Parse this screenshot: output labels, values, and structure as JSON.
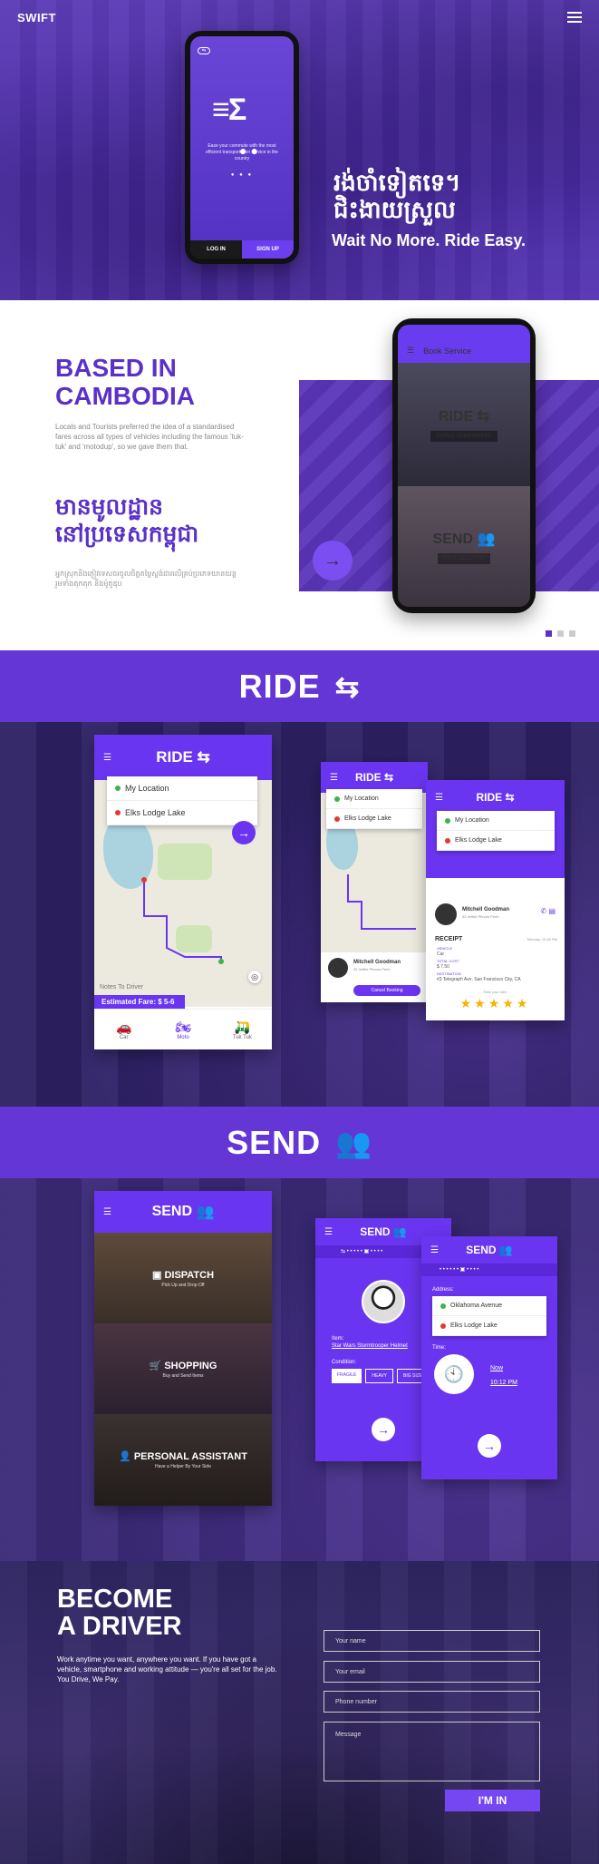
{
  "header": {
    "brand": "SWIFT"
  },
  "hero": {
    "khmer_title_line1": "រង់ចាំទៀតទេ។",
    "khmer_title_line2": "ជិះងាយស្រួល",
    "tagline": "Wait No More. Ride Easy.",
    "phone": {
      "tag": "Ease your commute with the most efficient transportation service in the country",
      "login": "LOG IN",
      "signup": "SIGN UP"
    }
  },
  "about": {
    "title_line1": "BASED IN",
    "title_line2": "CAMBODIA",
    "text": "Locals and Tourists preferred the idea of a standardised fares across all types of vehicles including the famous 'tuk-tuk' and 'motodup', so we gave them that.",
    "khmer_title_line1": "មានមូលដ្ឋាន",
    "khmer_title_line2": "នៅប្រទេសកម្ពុជា",
    "khmer_text": "អ្នកស្រុកនិងភ្ញៀវទេសចរចូលចិត្តតម្លៃស្តង់ដារលើគ្រប់ប្រភេទយានយន្ត រួមទាំងតុកតុក និងម៉ូតូឌុប",
    "phone": {
      "bar_title": "Book Service",
      "ride": "RIDE",
      "ride_sub": "GOING SOMEWHERE",
      "send": "SEND",
      "send_sub": "ITEM DELIVERY"
    }
  },
  "ride_banner": {
    "title": "RIDE"
  },
  "ride_cards": {
    "title": "RIDE",
    "my_location": "My Location",
    "destination": "Elks Lodge Lake",
    "notes": "Notes To Driver",
    "fare": "Estimated Fare: $ 5-6",
    "modes": [
      "Car",
      "Moto",
      "Tuk Tuk"
    ],
    "driver_name": "Mitchell Goodman",
    "driver_sub": "32 Jeffrie Phnom Penh",
    "cancel": "Cancel Booking",
    "receipt": "RECEIPT",
    "receipt_date": "Monday, 12:45 PM",
    "vehicle_label": "VEHICLE",
    "vehicle": "Car",
    "total_label": "TOTAL COST",
    "total": "$ 7.50",
    "dest_label": "DESTINATION",
    "dest": "#3 Telegraph Ave. San Francisco City, CA",
    "rate": "Rate your ride!"
  },
  "send_banner": {
    "title": "SEND"
  },
  "send_cards": {
    "title": "SEND",
    "dispatch": "DISPATCH",
    "dispatch_sub": "Pick Up and Drop Off",
    "shopping": "SHOPPING",
    "shopping_sub": "Buy and Send Items",
    "assistant": "PERSONAL ASSISTANT",
    "assistant_sub": "Have a Helper By Your Side",
    "item_label": "Item:",
    "item": "Star Wars Stormtrooper Helmet",
    "condition_label": "Condition:",
    "conditions": [
      "FRAGILE",
      "HEAVY",
      "BIG SIZE"
    ],
    "address_label": "Address:",
    "address1": "Oklahoma Avenue",
    "address2": "Elks Lodge Lake",
    "time_label": "Time:",
    "time_now": "Now",
    "time_val": "10:12 PM"
  },
  "driver": {
    "title_line1": "BECOME",
    "title_line2": "A DRIVER",
    "text": "Work anytime you want, anywhere you want. If you have got a vehicle, smartphone and working attitude — you're all set for the job. You Drive, We Pay.",
    "name_placeholder": "Your name",
    "email_placeholder": "Your email",
    "phone_placeholder": "Phone number",
    "message_placeholder": "Message",
    "submit": "I'M IN"
  },
  "colors": {
    "brand": "#6536d6",
    "accent": "#6a35f0",
    "heading": "#5a31c8"
  }
}
